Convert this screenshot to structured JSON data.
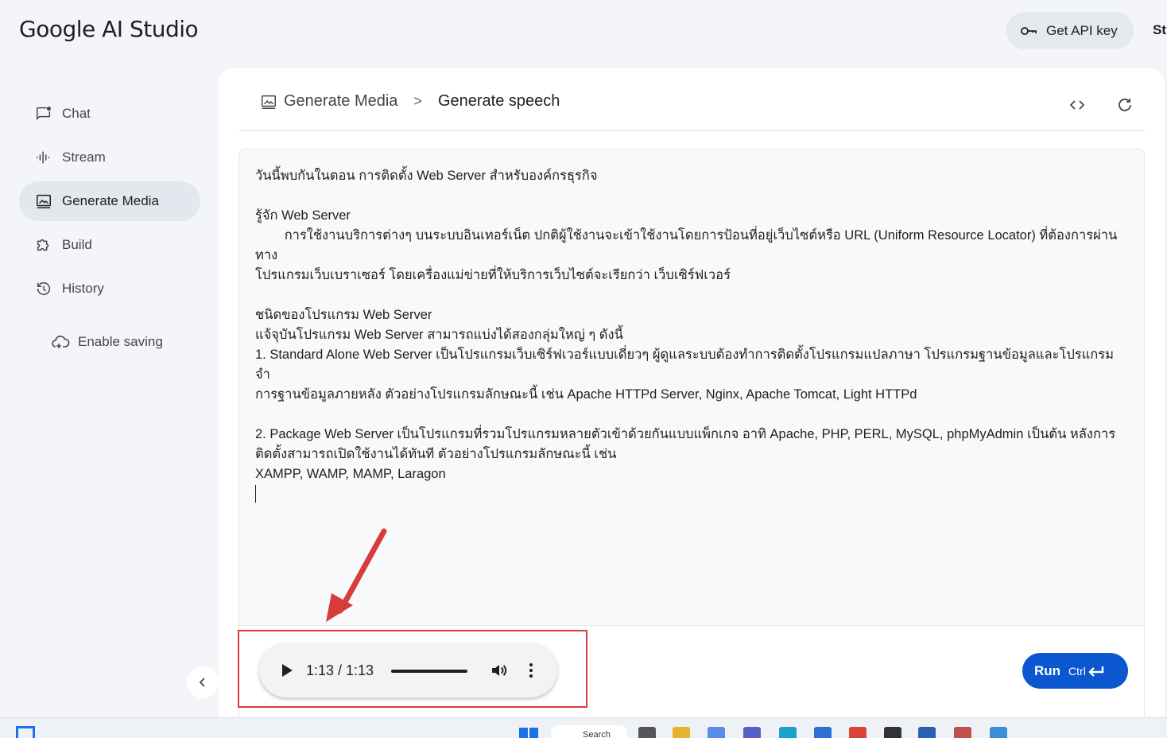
{
  "app": {
    "logo": "Google AI Studio",
    "api_key_button": "Get API key",
    "truncated_header_text": "St"
  },
  "sidebar": {
    "items": [
      {
        "label": "Chat",
        "icon": "chat-icon",
        "active": false
      },
      {
        "label": "Stream",
        "icon": "stream-icon",
        "active": false
      },
      {
        "label": "Generate Media",
        "icon": "image-icon",
        "active": true
      },
      {
        "label": "Build",
        "icon": "puzzle-icon",
        "active": false
      },
      {
        "label": "History",
        "icon": "history-icon",
        "active": false
      }
    ],
    "enable_saving": "Enable saving"
  },
  "breadcrumb": {
    "parent": "Generate Media",
    "separator": ">",
    "current": "Generate speech"
  },
  "editor": {
    "lines": [
      "วันนี้พบกันในตอน การติดตั้ง Web Server สำหรับองค์กรธุรกิจ",
      "",
      "รู้จัก Web Server",
      "        การใช้งานบริการต่างๆ บนระบบอินเทอร์เน็ต ปกติผู้ใช้งานจะเข้าใช้งานโดยการป้อนที่อยู่เว็บไซต์หรือ URL (Uniform Resource Locator) ที่ต้องการผ่านทาง",
      "โปรแกรมเว็บเบราเซอร์ โดยเครื่องแม่ข่ายที่ให้บริการเว็บไซต์จะเรียกว่า เว็บเซิร์ฟเวอร์",
      "",
      "ชนิดของโปรแกรม Web Server",
      "แจ้จุบันโปรแกรม Web Server สามารถแบ่งได้สองกลุ่มใหญ่ ๆ ดังนี้",
      "1. Standard Alone Web Server เป็นโปรแกรมเว็บเซิร์ฟเวอร์แบบเดี่ยวๆ ผู้ดูแลระบบต้องทำการติดตั้งโปรแกรมแปลภาษา โปรแกรมฐานข้อมูลและโปรแกรมจำ",
      "การฐานข้อมูลภายหลัง ตัวอย่างโปรแกรมลักษณะนี้ เช่น Apache HTTPd Server, Nginx, Apache Tomcat, Light HTTPd",
      "",
      "2. Package Web Server เป็นโปรแกรมที่รวมโปรแกรมหลายตัวเข้าด้วยกันแบบแพ็กเกจ อาทิ Apache, PHP, PERL, MySQL, phpMyAdmin เป็นต้น หลังการ",
      "ติดตั้งสามารถเปิดใช้งานได้ทันที ตัวอย่างโปรแกรมลักษณะนี้ เช่น",
      "XAMPP, WAMP, MAMP, Laragon"
    ]
  },
  "audio": {
    "time_display": "1:13 / 1:13",
    "progress": 1.0
  },
  "run_button": {
    "label": "Run",
    "shortcut": "Ctrl"
  },
  "taskbar": {
    "search_label": "Search"
  },
  "colors": {
    "accent": "#0b57d0",
    "annotation": "#d93a3a",
    "active_nav": "#e3e7ee"
  }
}
